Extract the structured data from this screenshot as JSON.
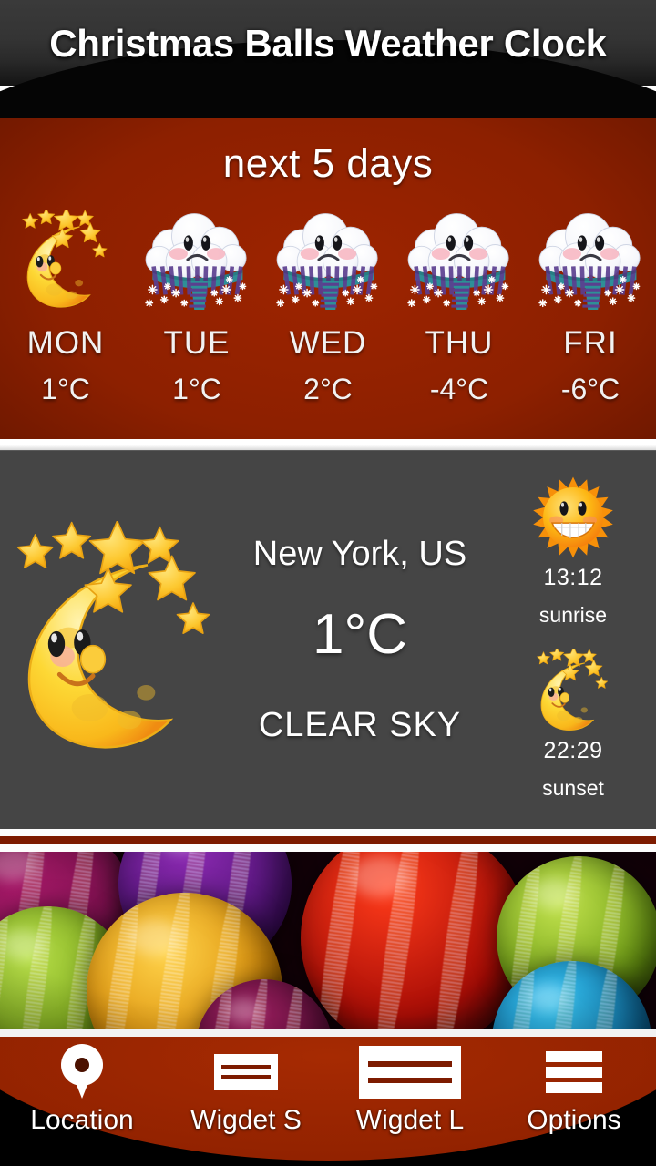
{
  "app": {
    "title": "Christmas Balls Weather Clock",
    "accent_red": "#8d2000",
    "panel_gray": "#454545",
    "text_white": "#ffffff"
  },
  "forecast": {
    "title": "next 5 days",
    "days": [
      {
        "day": "MON",
        "temp": "1°C",
        "icon": "moon-stars-icon",
        "condition": "clear-night"
      },
      {
        "day": "TUE",
        "temp": "1°C",
        "icon": "snow-cloud-icon",
        "condition": "snow"
      },
      {
        "day": "WED",
        "temp": "2°C",
        "icon": "snow-cloud-icon",
        "condition": "snow"
      },
      {
        "day": "THU",
        "temp": "-4°C",
        "icon": "snow-cloud-icon",
        "condition": "snow"
      },
      {
        "day": "FRI",
        "temp": "-6°C",
        "icon": "snow-cloud-icon",
        "condition": "snow"
      }
    ]
  },
  "current": {
    "city": "New York, US",
    "temperature": "1°C",
    "description": "CLEAR SKY",
    "main_icon": "moon-stars-icon",
    "sunrise": {
      "icon": "sun-icon",
      "time": "13:12",
      "label": "sunrise"
    },
    "sunset": {
      "icon": "moon-stars-icon",
      "time": "22:29",
      "label": "sunset"
    }
  },
  "banner": {
    "name": "christmas-balls-photo"
  },
  "bottom_bar": {
    "items": [
      {
        "label": "Location",
        "icon": "location-pin-icon"
      },
      {
        "label": "Wigdet S",
        "icon": "widget-small-icon"
      },
      {
        "label": "Wigdet L",
        "icon": "widget-large-icon"
      },
      {
        "label": "Options",
        "icon": "hamburger-menu-icon"
      }
    ]
  }
}
